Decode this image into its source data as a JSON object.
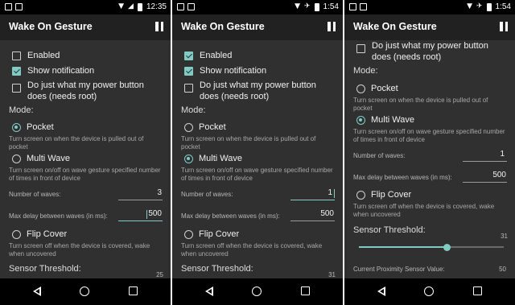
{
  "colors": {
    "accent": "#80cbc4",
    "background": "#303030",
    "appbar": "#212121",
    "statusbar": "#000000"
  },
  "phones": [
    {
      "status_time": "12:35",
      "app_title": "Wake On Gesture",
      "pause_icon": "pause-icon",
      "enabled_label": "Enabled",
      "enabled_checked": false,
      "notification_label": "Show notification",
      "notification_checked": true,
      "power_label": "Do just what my power button does (needs root)",
      "power_checked": false,
      "mode_label": "Mode:",
      "pocket_label": "Pocket",
      "pocket_desc": "Turn screen on when the device is pulled out of pocket",
      "multiwave_label": "Multi Wave",
      "multiwave_desc": "Turn screen on/off on wave gesture specified number of times in front of device",
      "waves_label": "Number of waves:",
      "waves_value": "3",
      "delay_label": "Max delay between waves (in ms):",
      "delay_value": "500",
      "flip_label": "Flip Cover",
      "flip_desc": "Turn screen off when the device is covered, wake when uncovered",
      "selected_mode": "pocket",
      "threshold_label": "Sensor Threshold:",
      "threshold_value": "25"
    },
    {
      "status_time": "1:54",
      "app_title": "Wake On Gesture",
      "pause_icon": "pause-icon",
      "enabled_label": "Enabled",
      "enabled_checked": true,
      "notification_label": "Show notification",
      "notification_checked": true,
      "power_label": "Do just what my power button does (needs root)",
      "power_checked": false,
      "mode_label": "Mode:",
      "pocket_label": "Pocket",
      "pocket_desc": "Turn screen on when the device is pulled out of pocket",
      "multiwave_label": "Multi Wave",
      "multiwave_desc": "Turn screen on/off on wave gesture specified number of times in front of device",
      "waves_label": "Number of waves:",
      "waves_value": "1",
      "delay_label": "Max delay between waves (in ms):",
      "delay_value": "500",
      "flip_label": "Flip Cover",
      "flip_desc": "Turn screen off when the device is covered, wake when uncovered",
      "selected_mode": "multiwave",
      "threshold_label": "Sensor Threshold:",
      "threshold_value": "31"
    },
    {
      "status_time": "1:54",
      "app_title": "Wake On Gesture",
      "pause_icon": "pause-icon",
      "power_label": "Do just what my power button does (needs root)",
      "power_checked": false,
      "mode_label": "Mode:",
      "pocket_label": "Pocket",
      "pocket_desc": "Turn screen on when the device is pulled out of pocket",
      "multiwave_label": "Multi Wave",
      "multiwave_desc": "Turn screen on/off on wave gesture specified number of times in front of device",
      "waves_label": "Number of waves:",
      "waves_value": "1",
      "delay_label": "Max delay between waves (in ms):",
      "delay_value": "500",
      "flip_label": "Flip Cover",
      "flip_desc": "Turn screen off when the device is covered, wake when uncovered",
      "selected_mode": "multiwave",
      "threshold_label": "Sensor Threshold:",
      "threshold_value": "31",
      "threshold_slider_fraction": 0.61,
      "proximity_label": "Current Proximity Sensor Value:",
      "proximity_value": "50"
    }
  ]
}
